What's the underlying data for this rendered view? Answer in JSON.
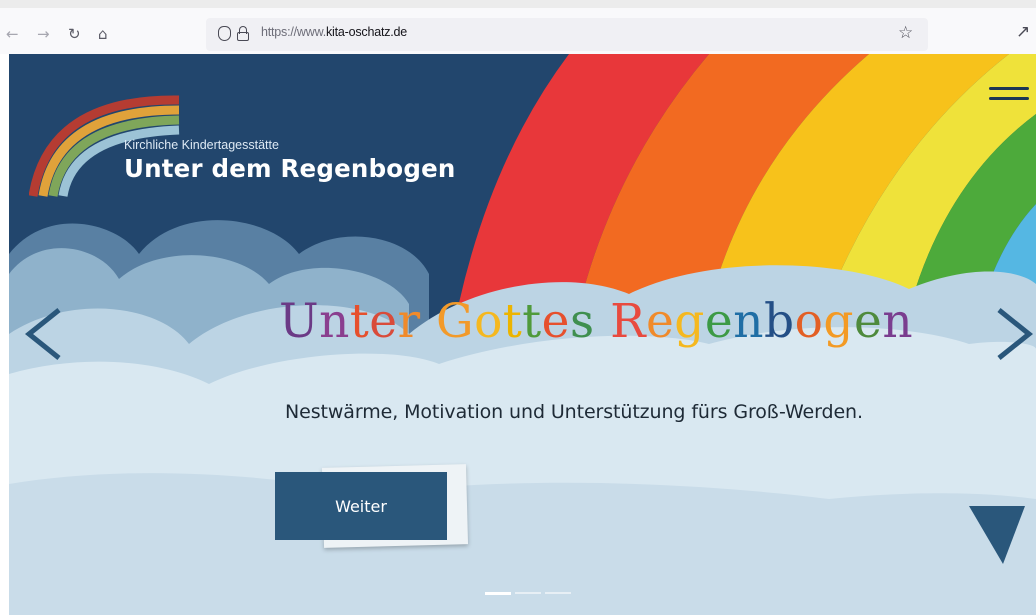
{
  "browser": {
    "url_prefix": "https://www.",
    "url_domain": "kita-oschatz.de",
    "icons": {
      "back": "arrow-left-icon",
      "forward": "arrow-right-icon",
      "reload": "reload-icon",
      "home": "home-icon",
      "tracking": "shield-icon",
      "lock": "lock-icon",
      "bookmark": "star-icon",
      "extensions": "puzzle-icon"
    }
  },
  "site": {
    "logo": {
      "subtitle": "Kirchliche Kindertagesstätte",
      "title": "Unter dem Regenbogen"
    },
    "menu": {
      "icon": "hamburger-icon"
    },
    "hero": {
      "headline": "Unter Gottes Regenbogen",
      "headline_colors": [
        "#6b3a86",
        "#8a3f8f",
        "#e6502d",
        "#d94b3a",
        "#f08a2a",
        "#f29a2a",
        "#f5b81f",
        "#ecb400",
        "#4f9a3b",
        "#e6502d",
        "#3f8f4f",
        "#e84a3f",
        "#f08a2a",
        "#f5b81f",
        "#3c9a45",
        "#1f6ea5",
        "#244f86",
        "#e35f25",
        "#f39a24",
        "#4e8a3c",
        "#7a3d8f",
        "#2e4a6c",
        "#c2452f"
      ],
      "tagline": "Nestwärme, Motivation und Unterstützung fürs Groß-Werden.",
      "cta_label": "Weiter"
    },
    "slider": {
      "slide_count": 3,
      "active_index": 0
    },
    "colors": {
      "sky": "#22466d",
      "cloud_light": "#d9e8f1",
      "cloud_mid": "#bcd4e4",
      "cloud_dark": "#8fb2cb",
      "button": "#2a577b",
      "arrow": "#2a577b",
      "rainbow": [
        "#e8373a",
        "#f26a21",
        "#f7c21b",
        "#efe23a",
        "#4daa3b",
        "#55b7e3"
      ]
    }
  }
}
